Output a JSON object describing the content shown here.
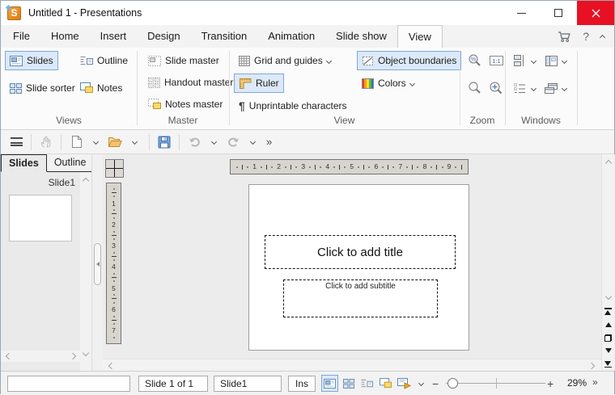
{
  "window": {
    "title": "Untitled 1 - Presentations",
    "app_icon_letter": "S"
  },
  "menu": {
    "tabs": [
      "File",
      "Home",
      "Insert",
      "Design",
      "Transition",
      "Animation",
      "Slide show",
      "View"
    ],
    "active_tab": "View",
    "help_glyph": "?"
  },
  "ribbon": {
    "views": {
      "label": "Views",
      "slides": "Slides",
      "outline": "Outline",
      "slide_sorter": "Slide sorter",
      "notes": "Notes"
    },
    "master": {
      "label": "Master",
      "slide_master": "Slide master",
      "handout_master": "Handout master",
      "notes_master": "Notes master"
    },
    "view": {
      "label": "View",
      "grid_and_guides": "Grid and guides",
      "ruler": "Ruler",
      "unprintable_characters": "Unprintable characters",
      "pilcrow": "¶",
      "object_boundaries": "Object boundaries",
      "colors": "Colors"
    },
    "zoom": {
      "label": "Zoom",
      "actual_size": "1:1"
    },
    "windows": {
      "label": "Windows"
    }
  },
  "toolbar": {
    "more": "»"
  },
  "sidebar": {
    "slides_tab": "Slides",
    "outline_tab": "Outline",
    "slide_label": "Slide1"
  },
  "slide": {
    "title_placeholder": "Click to add title",
    "subtitle_placeholder": "Click to add subtitle"
  },
  "rulers": {
    "horizontal_numbers": [
      1,
      2,
      3,
      4,
      5,
      6,
      7,
      8,
      9
    ],
    "vertical_numbers": [
      1,
      2,
      3,
      4,
      5,
      6,
      7
    ]
  },
  "statusbar": {
    "left_field": "",
    "slide_counter": "Slide 1 of 1",
    "slide_name": "Slide1",
    "insert_mode": "Ins",
    "zoom_out": "−",
    "zoom_in": "+",
    "zoom_level": "29%",
    "more": "»"
  },
  "colors": {
    "selection_bg": "#dbe9f8",
    "selection_border": "#7fa8d9",
    "close_button": "#e81123",
    "folder_orange": "#f3c36a",
    "note_yellow": "#ffd966",
    "save_blue": "#7aa7e0"
  }
}
